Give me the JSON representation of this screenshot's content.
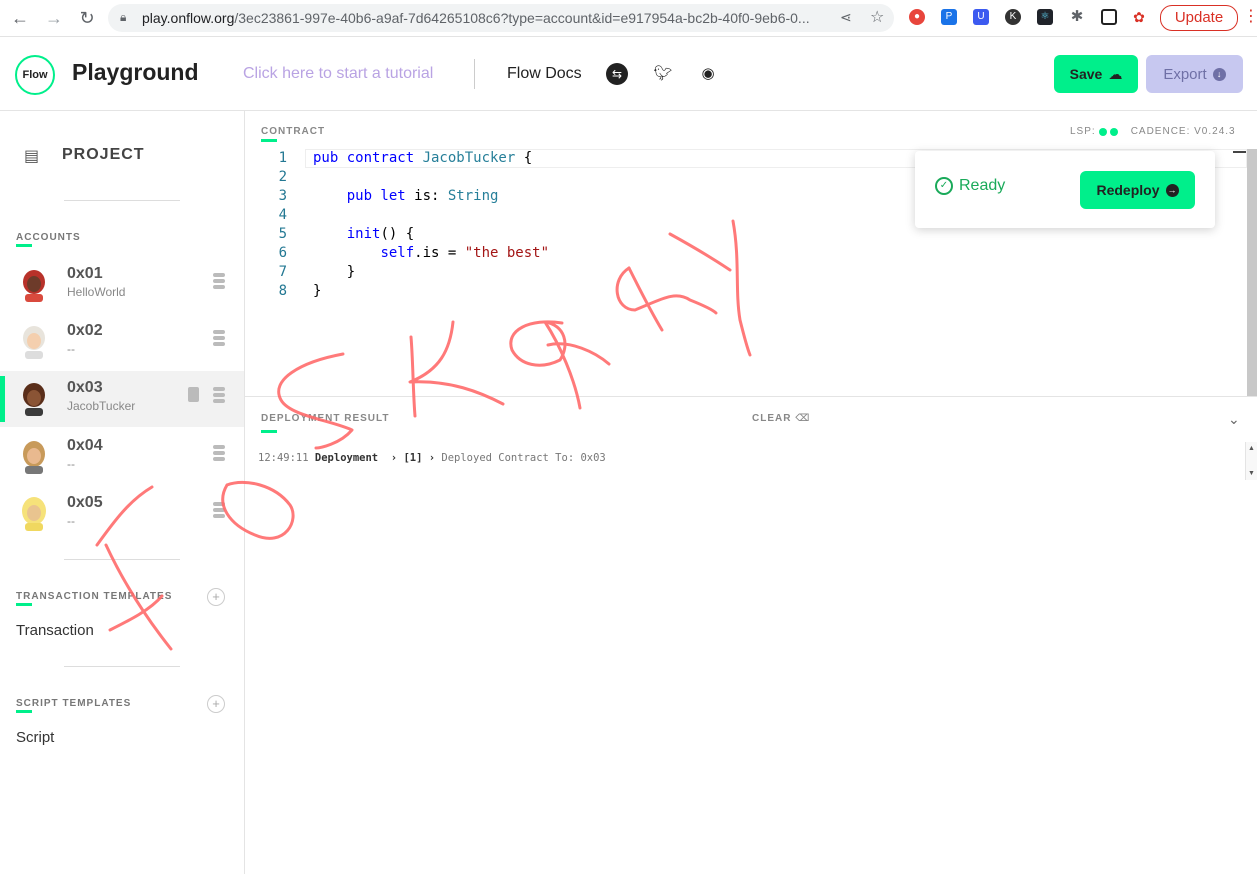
{
  "browser": {
    "url_main": "play.onflow.org",
    "url_rest": "/3ec23861-997e-40b6-a9af-7d64265108c6?type=account&id=e917954a-bc2b-40f0-9eb6-0...",
    "update_label": "Update"
  },
  "header": {
    "logo_text": "Flow",
    "title": "Playground",
    "tutorial_link": "Click here to start a tutorial",
    "docs_link": "Flow Docs",
    "save_label": "Save",
    "export_label": "Export"
  },
  "sidebar": {
    "project_label": "PROJECT",
    "accounts_title": "ACCOUNTS",
    "accounts": [
      {
        "address": "0x01",
        "name": "HelloWorld",
        "selected": false
      },
      {
        "address": "0x02",
        "name": "--",
        "selected": false
      },
      {
        "address": "0x03",
        "name": "JacobTucker",
        "selected": true
      },
      {
        "address": "0x04",
        "name": "--",
        "selected": false
      },
      {
        "address": "0x05",
        "name": "--",
        "selected": false
      }
    ],
    "transaction_templates_title": "TRANSACTION TEMPLATES",
    "transaction_item": "Transaction",
    "script_templates_title": "SCRIPT TEMPLATES",
    "script_item": "Script"
  },
  "editor": {
    "pane_label": "CONTRACT",
    "lsp_label": "LSP:",
    "cadence_version": "CADENCE: V0.24.3",
    "line_numbers": [
      "1",
      "2",
      "3",
      "4",
      "5",
      "6",
      "7",
      "8"
    ]
  },
  "toast": {
    "status": "Ready",
    "redeploy_label": "Redeploy"
  },
  "result": {
    "pane_label": "DEPLOYMENT RESULT",
    "clear_label": "CLEAR",
    "log_time": "12:49:11",
    "log_kind": "Deployment",
    "log_index": "[1]",
    "log_message": "Deployed Contract To: 0x03"
  },
  "colors": {
    "accent": "#00ef8b",
    "export_bg": "#c7c8f0",
    "scribble": "#ff6b6b"
  }
}
